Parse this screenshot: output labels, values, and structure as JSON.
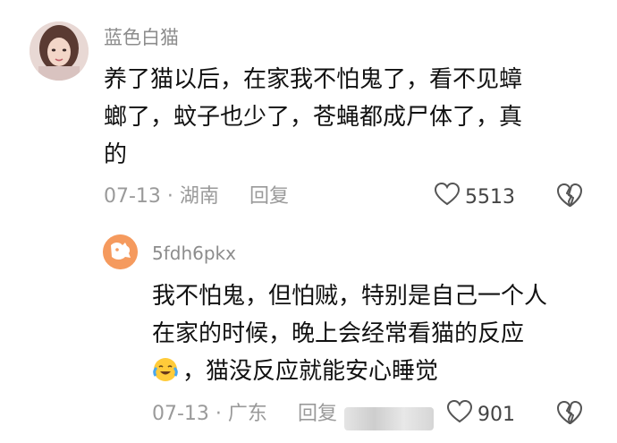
{
  "comments": [
    {
      "username": "蓝色白猫",
      "lines": [
        "养了猫以后，在家我不怕鬼了，看不见蟑",
        "螂了，蚊子也少了，苍蝇都成尸体了，真",
        "的"
      ],
      "meta": "07-13 · 湖南",
      "reply_label": "回复",
      "likes": "5513",
      "icons": {
        "like": "heart-icon",
        "dislike": "broken-heart-icon"
      }
    },
    {
      "username": "5fdh6pkx",
      "lines": [
        "我不怕鬼，但怕贼，特别是自己一个人",
        "在家的时候，晚上会经常看猫的反应",
        "，猫没反应就能安心睡觉"
      ],
      "meta": "07-13 · 广东",
      "reply_label": "回复",
      "likes": "901",
      "icons": {
        "like": "heart-icon",
        "dislike": "broken-heart-icon",
        "emoji": "crying-laughing-emoji"
      }
    }
  ],
  "colors": {
    "meta": "#9a9a9a",
    "text": "#111111",
    "username": "#8c8c8c"
  }
}
